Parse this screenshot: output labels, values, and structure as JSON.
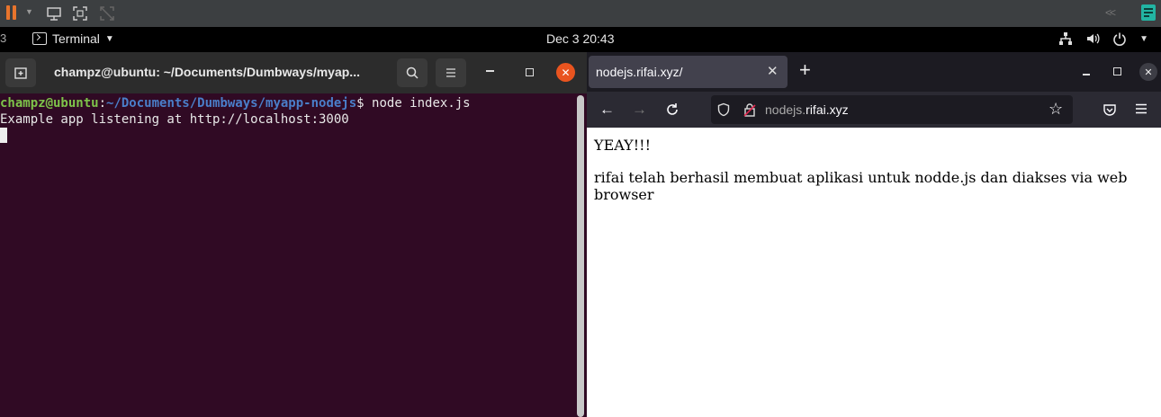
{
  "topbar": {
    "app_name": "Terminal",
    "clock": "Dec 3  20:43"
  },
  "terminal": {
    "title": "champz@ubuntu: ~/Documents/Dumbways/myap...",
    "prompt_user": "champz@ubuntu",
    "prompt_sep": ":",
    "prompt_path": "~/Documents/Dumbways/myapp-nodejs",
    "prompt_symbol": "$ ",
    "command": "node index.js",
    "output": "Example app listening at http://localhost:3000",
    "background": "#300a24"
  },
  "browser": {
    "tab_title": "nodejs.rifai.xyz/",
    "url_host_prefix": "nodejs.",
    "url_host_domain": "rifai.xyz",
    "page": {
      "heading": "YEAY!!!",
      "body": "rifai telah berhasil membuat aplikasi untuk nodde.js dan diakses via web browser"
    }
  },
  "colors": {
    "close_button": "#e9541f",
    "vm_pause": "#e8742c",
    "notes_icon": "#22b5a3"
  }
}
